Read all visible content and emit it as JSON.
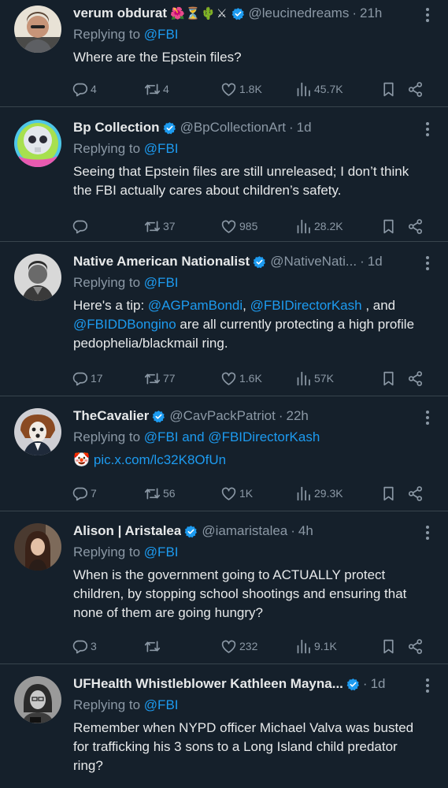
{
  "tweets": [
    {
      "name": "verum obdurat",
      "name_emoji": "🌺⏳🌵⚔",
      "verified": true,
      "handle": "@leucinedreams",
      "time": "21h",
      "replying_label": "Replying to",
      "replying_to": "@FBI",
      "text": "Where are the Epstein files?",
      "replies": "4",
      "retweets": "4",
      "likes": "1.8K",
      "views": "45.7K"
    },
    {
      "name": "Bp Collection",
      "verified": true,
      "handle": "@BpCollectionArt",
      "time": "1d",
      "replying_label": "Replying to",
      "replying_to": "@FBI",
      "text": "Seeing that Epstein files are still unreleased; I don’t think the FBI actually cares about children’s safety.",
      "replies": "",
      "retweets": "37",
      "likes": "985",
      "views": "28.2K"
    },
    {
      "name": "Native American Nationalist",
      "verified": true,
      "handle": "@NativeNati...",
      "time": "1d",
      "replying_label": "Replying to",
      "replying_to": "@FBI",
      "text_parts": {
        "t1": "Here's a tip: ",
        "m1": "@AGPamBondi",
        "t2": ", ",
        "m2": "@FBIDirectorKash",
        "t3": " , and ",
        "m3": "@FBIDDBongino",
        "t4": " are all currently protecting a high profile pedophelia/blackmail ring."
      },
      "replies": "17",
      "retweets": "77",
      "likes": "1.6K",
      "views": "57K"
    },
    {
      "name": "TheCavalier",
      "verified": true,
      "handle": "@CavPackPatriot",
      "time": "22h",
      "replying_label": "Replying to",
      "replying_to": "@FBI and @FBIDirectorKash",
      "clown": "🤡",
      "link": "pic.x.com/lc32K8OfUn",
      "replies": "7",
      "retweets": "56",
      "likes": "1K",
      "views": "29.3K"
    },
    {
      "name": "Alison | Aristalea",
      "verified": true,
      "handle": "@iamaristalea",
      "time": "4h",
      "replying_label": "Replying to",
      "replying_to": "@FBI",
      "text": "When is the government going to ACTUALLY protect children, by stopping school shootings and ensuring that none of them are going hungry?",
      "replies": "3",
      "retweets": "",
      "likes": "232",
      "views": "9.1K"
    },
    {
      "name": "UFHealth Whistleblower Kathleen Mayna...",
      "verified": true,
      "handle": "",
      "time": "1d",
      "replying_label": "Replying to",
      "replying_to": "@FBI",
      "text": "Remember when NYPD officer Michael Valva was busted for trafficking his 3 sons to a Long Island child predator ring?"
    }
  ],
  "colors": {
    "background": "#15202b",
    "text": "#e7e9ea",
    "muted": "#8b98a5",
    "accent": "#1d9bf0",
    "divider": "#38444d"
  },
  "icons": [
    "reply-icon",
    "retweet-icon",
    "like-icon",
    "views-icon",
    "bookmark-icon",
    "share-icon",
    "more-icon",
    "verified-badge-icon"
  ]
}
